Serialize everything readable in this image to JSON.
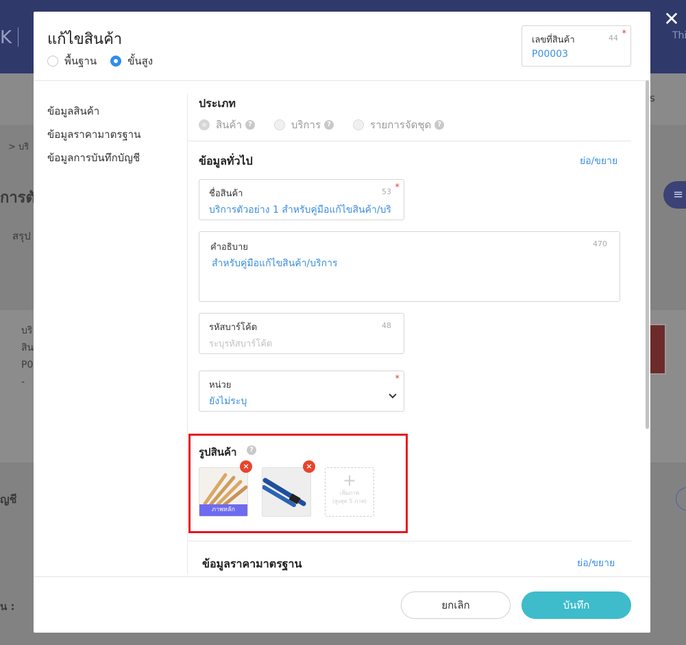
{
  "background": {
    "logo_glyph": "K",
    "top_right_text": "Thi",
    "nav_right_text": "s",
    "breadcrumb_text": "> บริ",
    "page_title_partial": "การตั",
    "tab_partial": "สรุป",
    "list_lines": [
      "บริ",
      "สิน",
      "P0",
      "-"
    ],
    "section_partial": "ัญชี",
    "bottom_label_partial": "ุน :",
    "menu_icon": "hamburger-icon"
  },
  "modal": {
    "title": "แก้ไขสินค้า",
    "close_icon": "close-icon",
    "modes": [
      {
        "label": "พื้นฐาน",
        "selected": false
      },
      {
        "label": "ขั้นสูง",
        "selected": true
      }
    ],
    "product_code": {
      "label": "เลขที่สินค้า",
      "count": "44",
      "required_mark": "*",
      "value": "P00003"
    },
    "side_nav": [
      "ข้อมูลสินค้า",
      "ข้อมูลราคามาตรฐาน",
      "ข้อมูลการบันทึกบัญชี"
    ],
    "type_section": {
      "title": "ประเภท",
      "options": [
        {
          "label": "สินค้า",
          "selected": true
        },
        {
          "label": "บริการ",
          "selected": false
        },
        {
          "label": "รายการจัดชุด",
          "selected": false
        }
      ]
    },
    "general_section": {
      "title": "ข้อมูลทั่วไป",
      "toggle": "ย่อ/ขยาย",
      "name": {
        "label": "ชื่อสินค้า",
        "count": "53",
        "required_mark": "*",
        "value": "บริการตัวอย่าง 1 สำหรับคู่มือแก้ไขสินค้า/บริ"
      },
      "description": {
        "label": "คำอธิบาย",
        "count": "470",
        "value": "สำหรับคู่มือแก้ไขสินค้า/บริการ"
      },
      "barcode": {
        "label": "รหัสบาร์โค้ด",
        "count": "48",
        "placeholder": "ระบุรหัสบาร์โค้ด"
      },
      "unit": {
        "label": "หน่วย",
        "required_mark": "*",
        "value": "ยังไม่ระบุ"
      }
    },
    "images_section": {
      "title": "รูปสินค้า",
      "main_tag": "ภาพหลัก",
      "delete_glyph": "×",
      "add_plus": "+",
      "add_label_line1": "เพิ่มภาพ",
      "add_label_line2": "(สูงสุด 5 ภาพ)",
      "highlight_color": "#e8141e"
    },
    "price_section": {
      "title": "ข้อมูลราคามาตรฐาน",
      "toggle": "ย่อ/ขยาย"
    },
    "footer": {
      "cancel": "ยกเลิก",
      "save": "บันทึก"
    }
  },
  "colors": {
    "accent_blue": "#2f8cf0",
    "link_blue": "#3b8ede",
    "save_teal": "#3ebccb",
    "required_red": "#e0402e",
    "main_tag_purple": "#6f6bef"
  }
}
